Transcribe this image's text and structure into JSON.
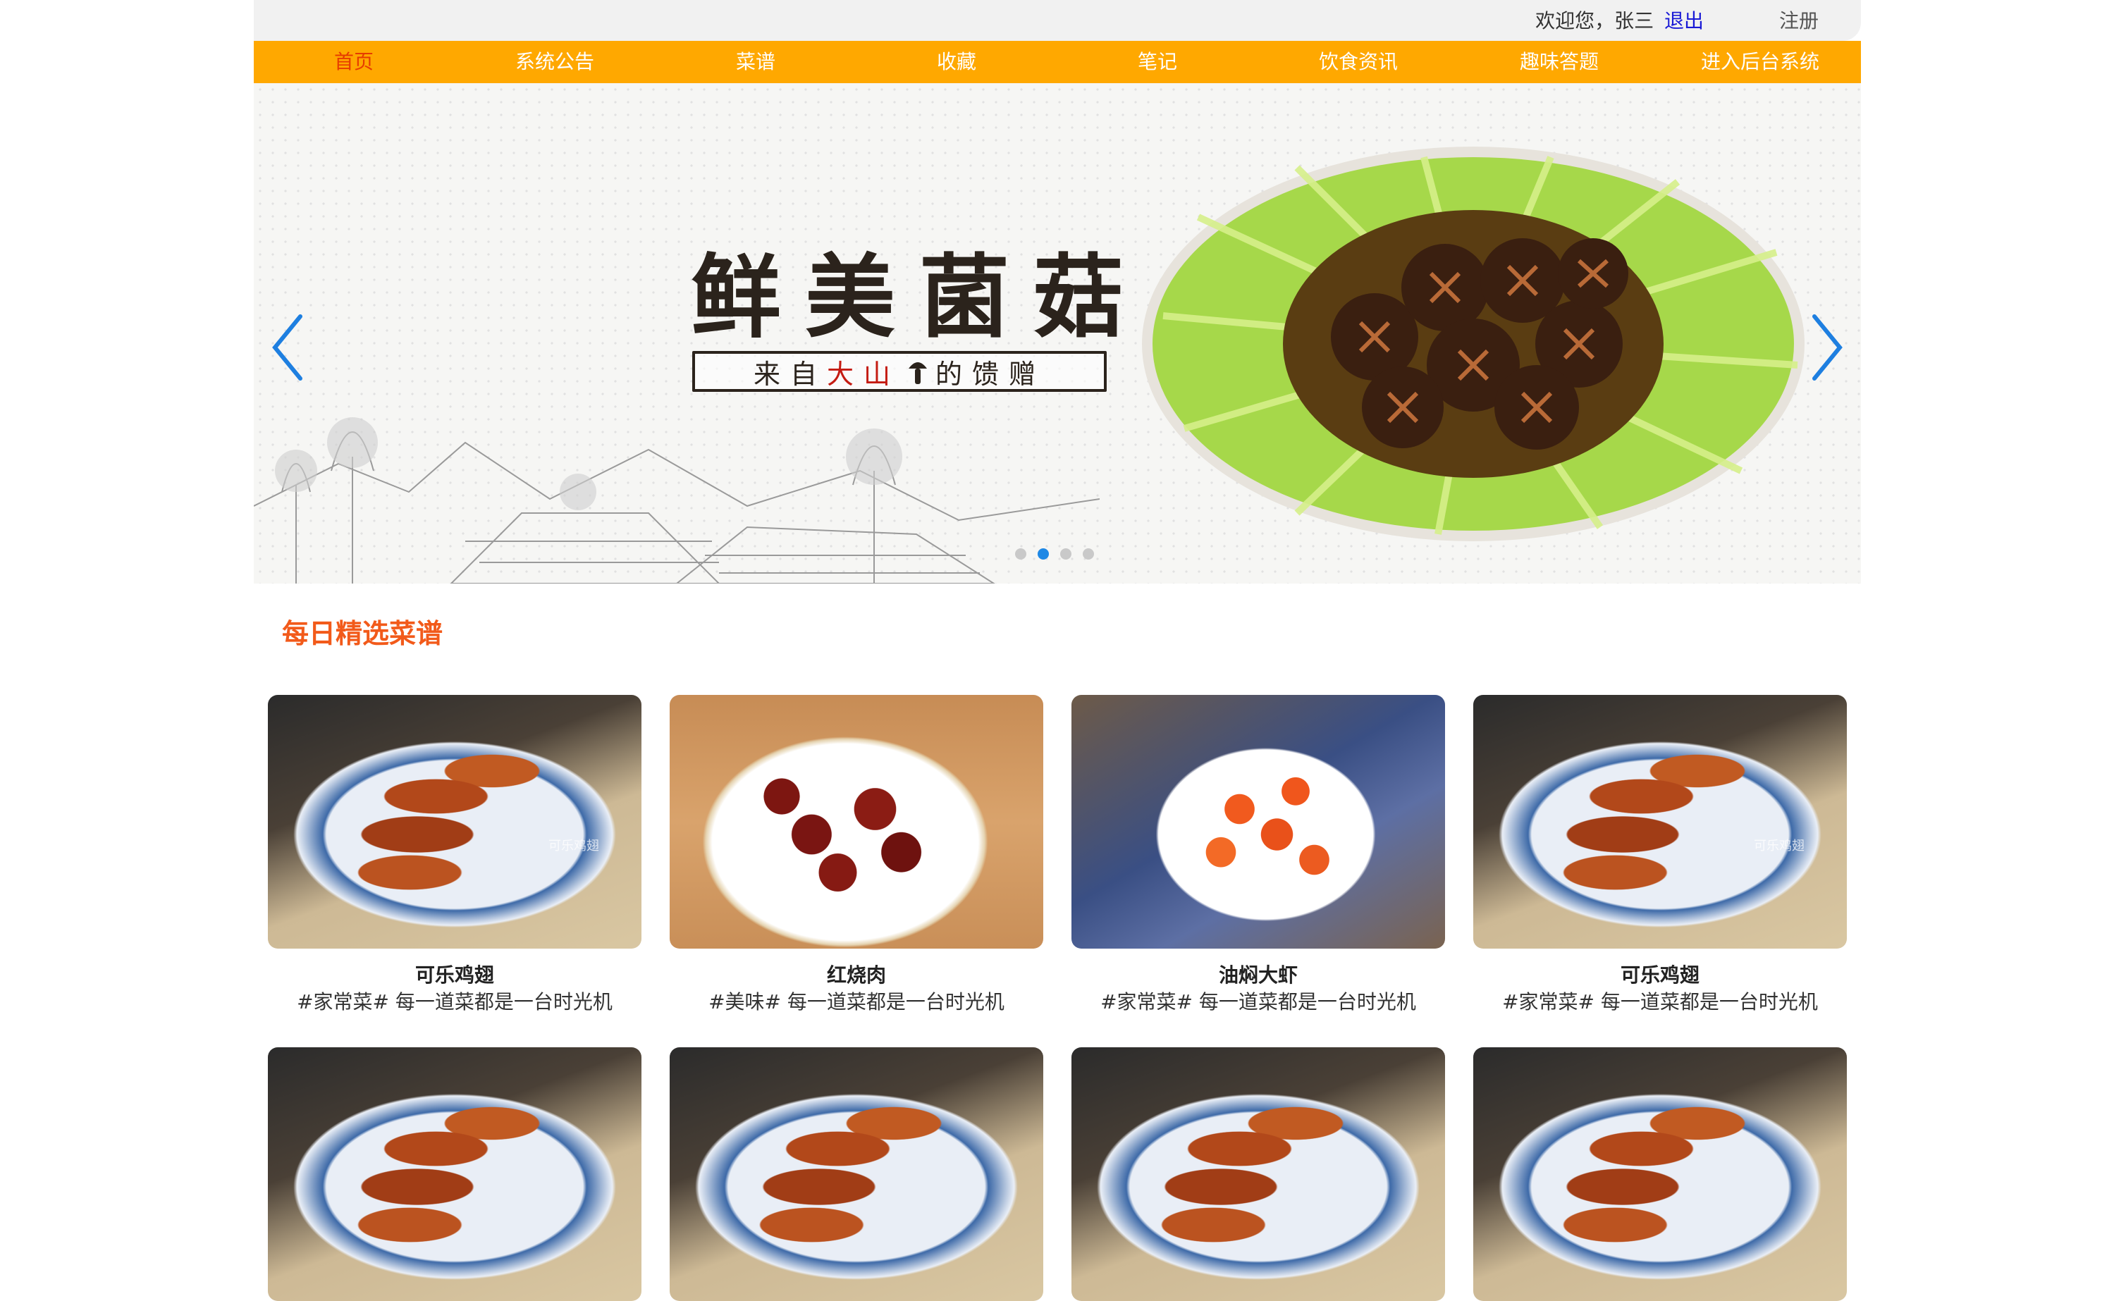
{
  "userbar": {
    "welcome": "欢迎您，张三",
    "logout": "退出",
    "register": "注册"
  },
  "nav": {
    "items": [
      {
        "label": "首页",
        "active": true
      },
      {
        "label": "系统公告"
      },
      {
        "label": "菜谱"
      },
      {
        "label": "收藏"
      },
      {
        "label": "笔记"
      },
      {
        "label": "饮食资讯"
      },
      {
        "label": "趣味答题"
      },
      {
        "label": "进入后台系统"
      }
    ]
  },
  "banner": {
    "headline": "鲜美菌菇",
    "tagline_pre": "来自",
    "tagline_red": "大山",
    "tagline_post": "的馈赠",
    "slides": 4,
    "active_slide": 2
  },
  "section": {
    "title": "每日精选菜谱"
  },
  "recipes": [
    {
      "name": "可乐鸡翅",
      "desc": "#家常菜# 每一道菜都是一台时光机",
      "image": "wings",
      "watermark": "可乐鸡翅"
    },
    {
      "name": "红烧肉",
      "desc": "#美味# 每一道菜都是一台时光机",
      "image": "pork",
      "watermark": ""
    },
    {
      "name": "油焖大虾",
      "desc": "#家常菜# 每一道菜都是一台时光机",
      "image": "shrimp",
      "watermark": ""
    },
    {
      "name": "可乐鸡翅",
      "desc": "#家常菜# 每一道菜都是一台时光机",
      "image": "wings",
      "watermark": "可乐鸡翅"
    },
    {
      "name": "",
      "desc": "",
      "image": "wings",
      "watermark": ""
    },
    {
      "name": "",
      "desc": "",
      "image": "wings",
      "watermark": ""
    },
    {
      "name": "",
      "desc": "",
      "image": "wings",
      "watermark": ""
    },
    {
      "name": "",
      "desc": "",
      "image": "wings",
      "watermark": ""
    }
  ],
  "colors": {
    "nav_bg": "#ffa800",
    "nav_active": "#e63c00",
    "section_title": "#f25a1a",
    "logout_link": "#1a1ad6",
    "dot_active": "#1e88e5"
  },
  "icons": {
    "prev": "chevron-left-icon",
    "next": "chevron-right-icon"
  }
}
